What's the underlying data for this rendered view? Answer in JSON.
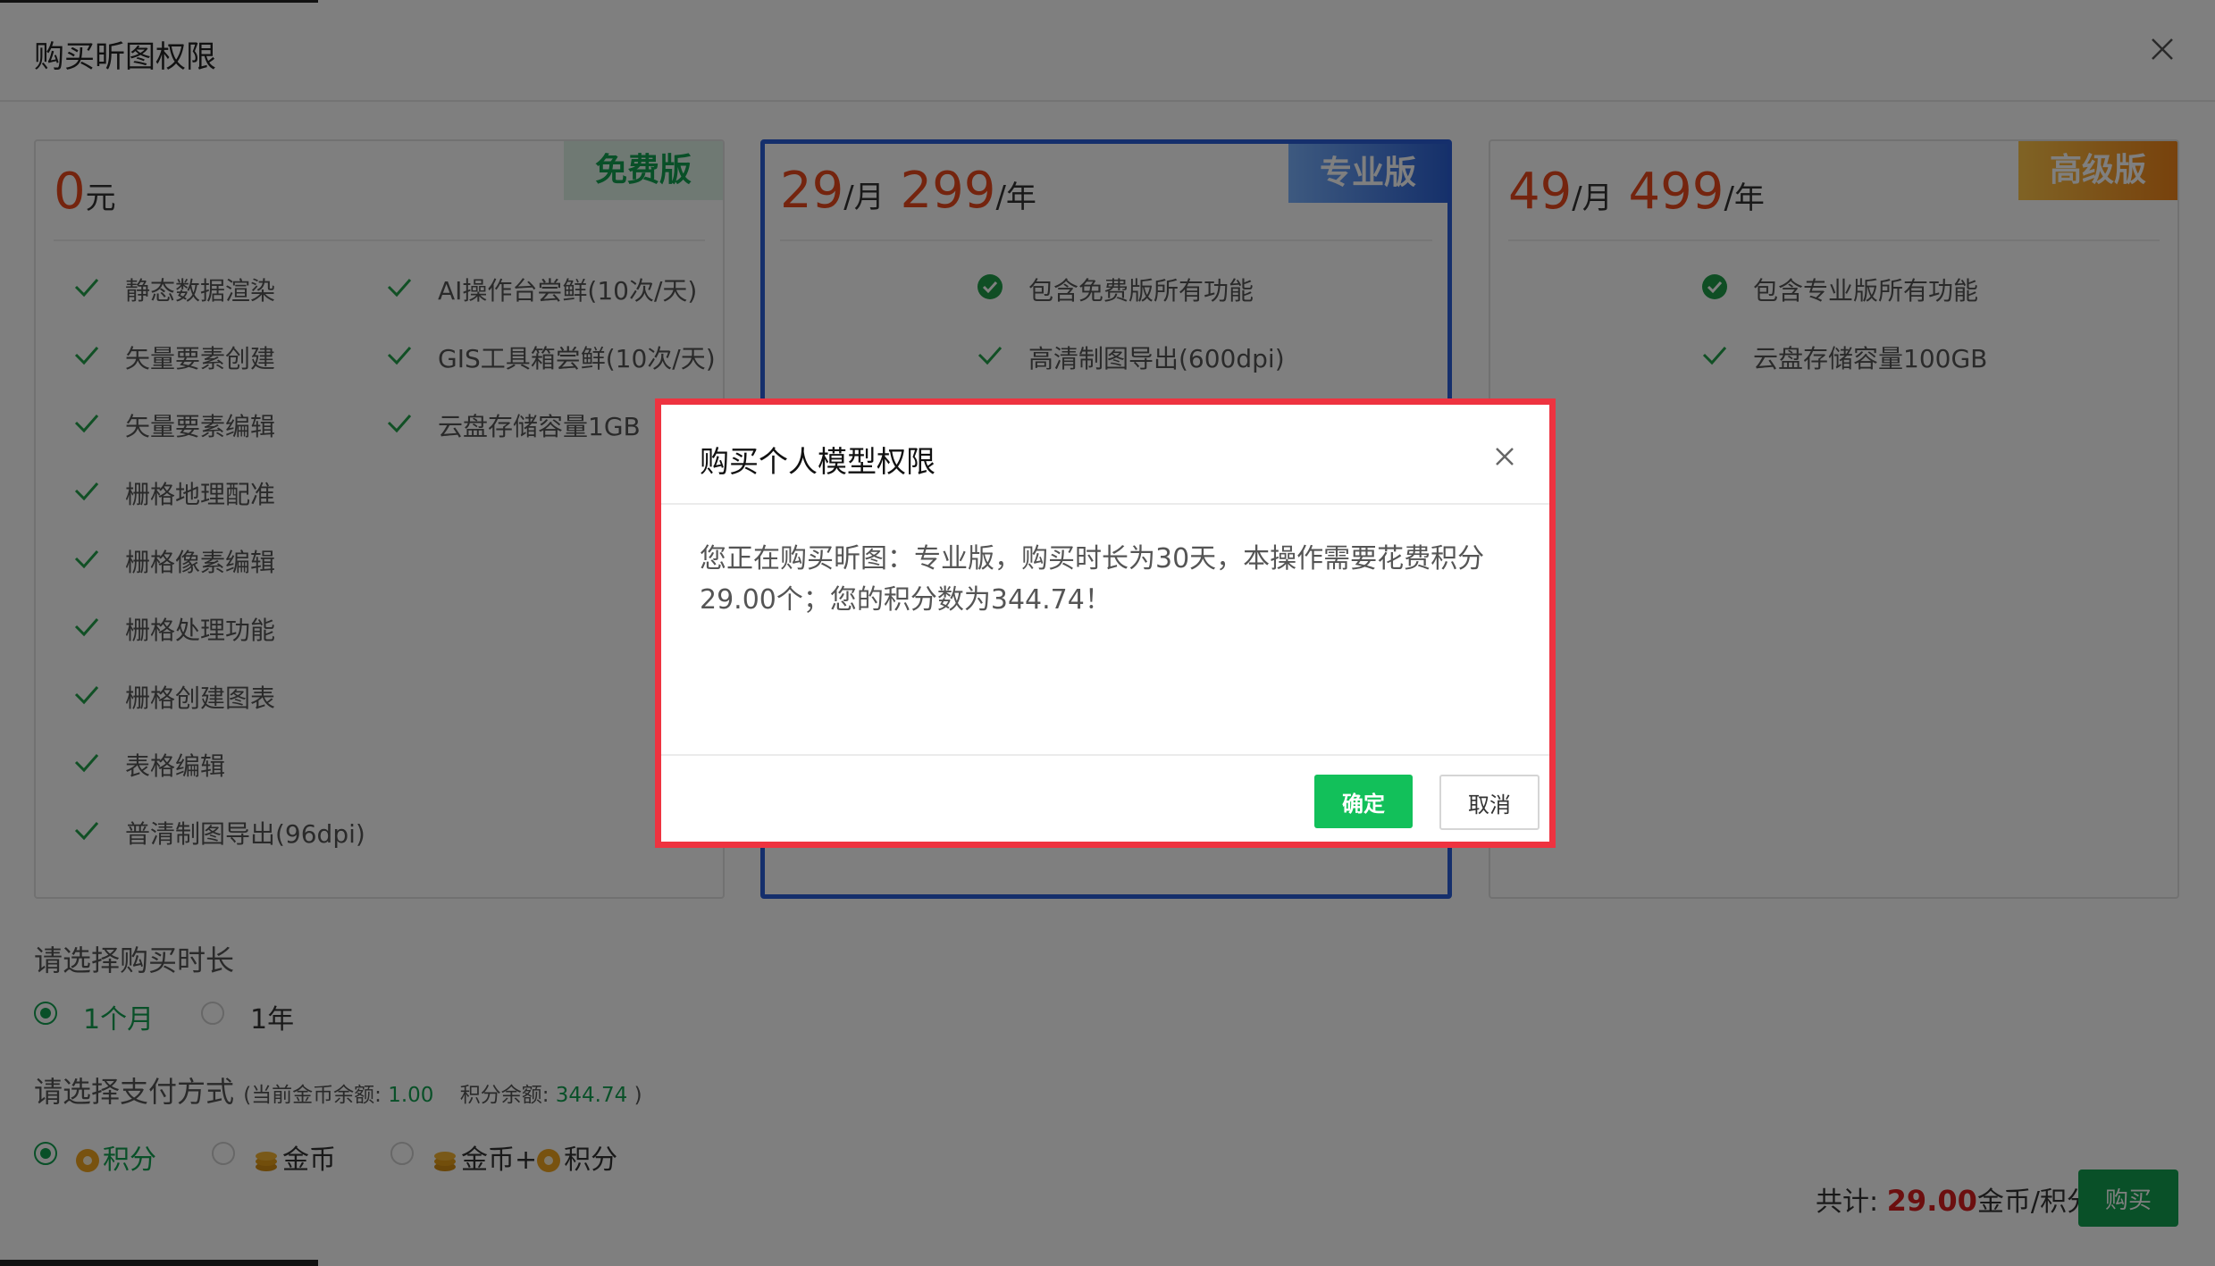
{
  "header": {
    "title": "购买昕图权限"
  },
  "plans": {
    "free": {
      "ribbon": "免费版",
      "price": "0",
      "unit": "元",
      "features_left": [
        "静态数据渲染",
        "矢量要素创建",
        "矢量要素编辑",
        "栅格地理配准",
        "栅格像素编辑",
        "栅格处理功能",
        "栅格创建图表",
        "表格编辑",
        "普清制图导出(96dpi)"
      ],
      "features_right": [
        "AI操作台尝鲜(10次/天)",
        "GIS工具箱尝鲜(10次/天)",
        "云盘存储容量1GB"
      ]
    },
    "pro": {
      "ribbon": "专业版",
      "price_month": "29",
      "unit_month": "/月",
      "price_year": "299",
      "unit_year": "/年",
      "features": [
        "包含免费版所有功能",
        "高清制图导出(600dpi)"
      ]
    },
    "adv": {
      "ribbon": "高级版",
      "price_month": "49",
      "unit_month": "/月",
      "price_year": "499",
      "unit_year": "/年",
      "features": [
        "包含专业版所有功能",
        "云盘存储容量100GB"
      ]
    }
  },
  "duration": {
    "label": "请选择购买时长",
    "options": [
      "1个月",
      "1年"
    ],
    "selected": "1个月"
  },
  "payment": {
    "label": "请选择支付方式",
    "balance_prefix": "(当前金币余额:",
    "gold_balance": "1.00",
    "points_prefix": "积分余额:",
    "points_balance": "344.74",
    "balance_suffix": ")",
    "options": [
      "积分",
      "金币",
      "金币+",
      "积分"
    ],
    "selected": "积分"
  },
  "total": {
    "prefix": "共计:",
    "amount": "29.00",
    "suffix": "金币/积分",
    "buy_label": "购买"
  },
  "dialog": {
    "title": "购买个人模型权限",
    "message": "您正在购买昕图：专业版，购买时长为30天，本操作需要花费积分29.00个；您的积分数为344.74！",
    "confirm_label": "确定",
    "cancel_label": "取消"
  },
  "colors": {
    "accent_green": "#12a150",
    "price_red": "#e8491d",
    "pro_blue": "#2b5fd9",
    "highlight_red": "#ee3340"
  }
}
